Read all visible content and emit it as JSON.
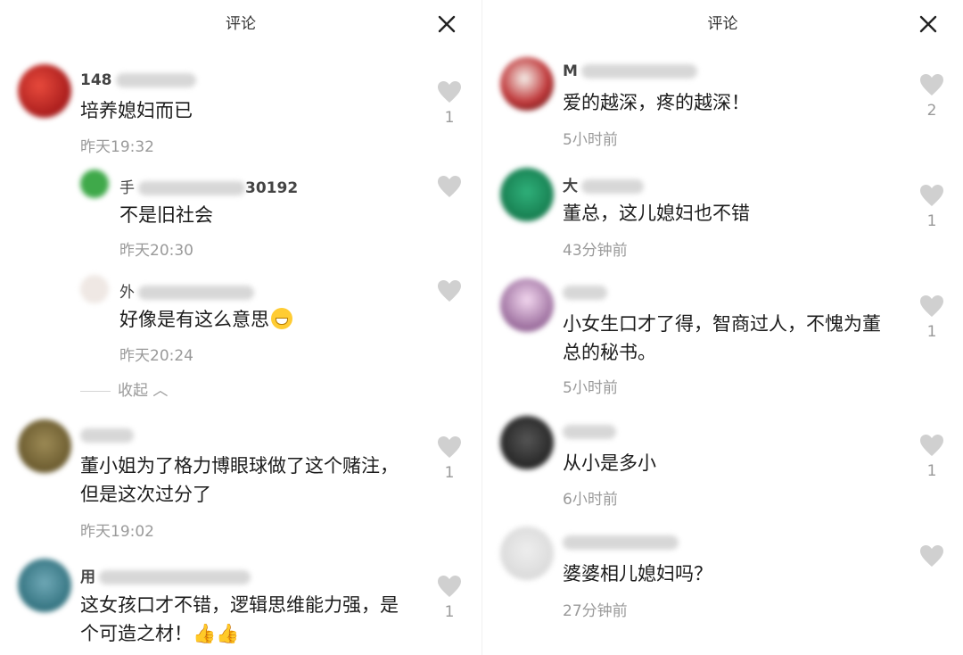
{
  "left": {
    "title": "评论",
    "comments": [
      {
        "name_visible": "148",
        "text": "培养媳妇而已",
        "time": "昨天19:32",
        "likes": "1"
      },
      {
        "name_visible": "手",
        "name_suffix": "30192",
        "text": "不是旧社会",
        "time": "昨天20:30",
        "likes": ""
      },
      {
        "name_visible": "外",
        "text": "好像是有这么意思",
        "time": "昨天20:24",
        "likes": ""
      },
      {
        "text": "董小姐为了格力博眼球做了这个赌注，但是这次过分了",
        "time": "昨天19:02",
        "likes": "1"
      },
      {
        "name_visible": "用",
        "text": "这女孩口才不错，逻辑思维能力强，是个可造之材！👍👍",
        "likes": "1"
      }
    ],
    "collapse_label": "收起 ︿"
  },
  "right": {
    "title": "评论",
    "comments": [
      {
        "name_visible": "M",
        "text": "爱的越深，疼的越深！",
        "time": "5小时前",
        "likes": "2"
      },
      {
        "name_visible": "大",
        "text": "董总，这儿媳妇也不错",
        "time": "43分钟前",
        "likes": "1"
      },
      {
        "text": "小女生口才了得，智商过人，不愧为董总的秘书。",
        "time": "5小时前",
        "likes": "1"
      },
      {
        "text": "从小是多小",
        "time": "6小时前",
        "likes": "1"
      },
      {
        "text": "婆婆相儿媳妇吗？",
        "time": "27分钟前",
        "likes": ""
      }
    ]
  },
  "colors": {
    "text": "#1c1c1c",
    "meta": "#9a9a9a",
    "like_icon": "#d0d0d0"
  },
  "icons": {
    "close": "close-icon",
    "like": "heart-icon",
    "emoji": "grin-emoji-icon",
    "thumbs": "thumbs-up-emoji-icon"
  }
}
